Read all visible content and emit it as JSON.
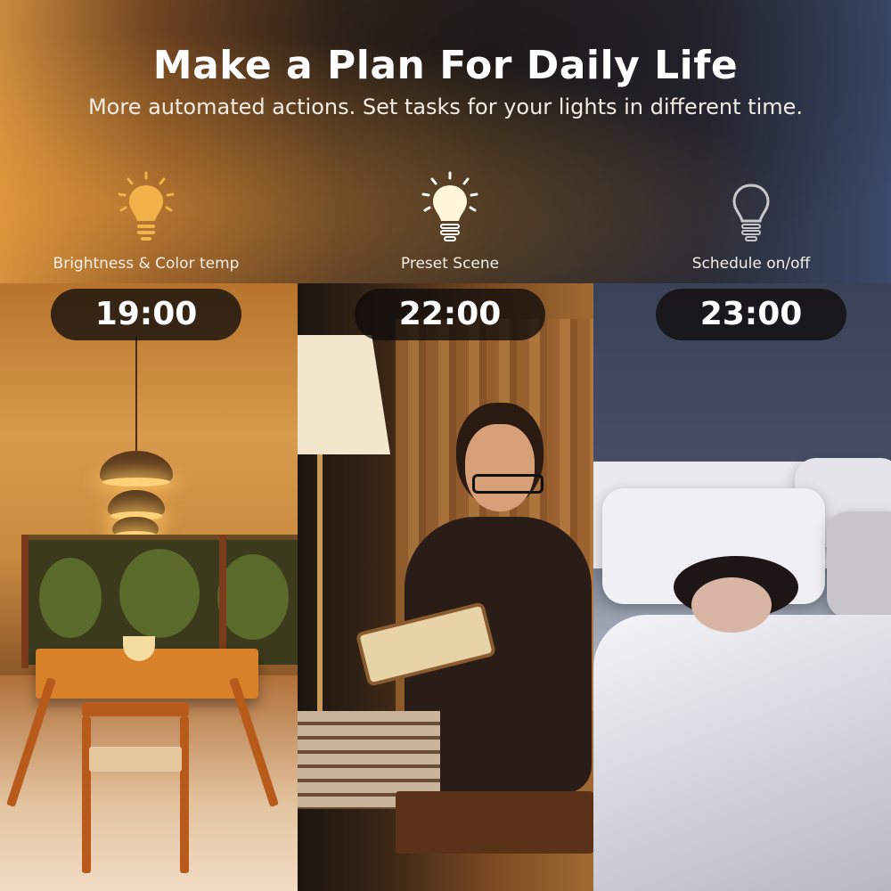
{
  "headline": "Make a Plan For Daily Life",
  "subline": "More automated actions. Set tasks for your lights in different time.",
  "columns": [
    {
      "icon": "bulb-bright-warm-icon",
      "label": "Brightness & Color temp",
      "time": "19:00",
      "bulb_color": "#f2b24a"
    },
    {
      "icon": "bulb-bright-white-icon",
      "label": "Preset Scene",
      "time": "22:00",
      "bulb_color": "#fff6dc"
    },
    {
      "icon": "bulb-off-icon",
      "label": "Schedule on/off",
      "time": "23:00",
      "bulb_color": "#c8c8cc"
    }
  ]
}
